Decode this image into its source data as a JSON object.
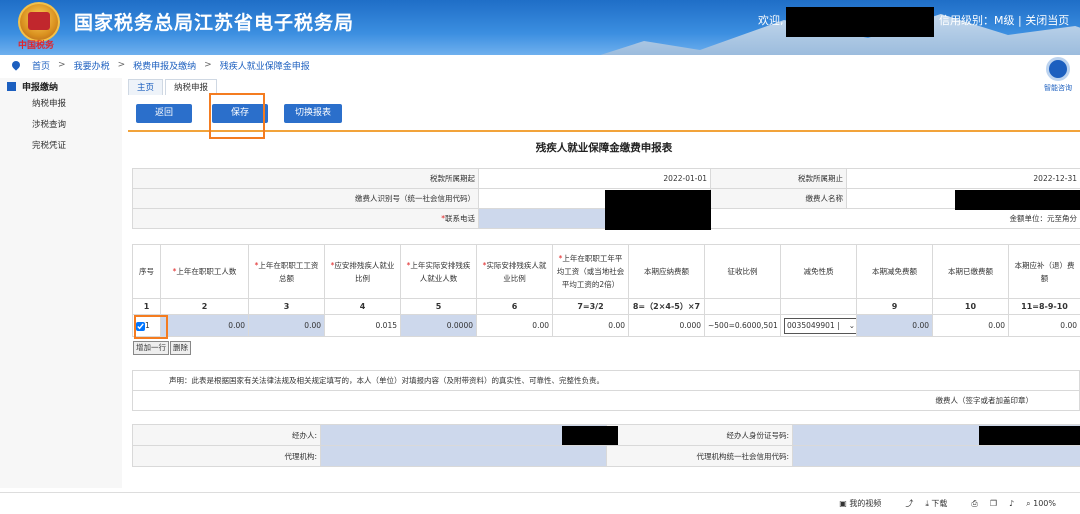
{
  "header": {
    "mark": "中国税务",
    "title": "国家税务总局江苏省电子税务局",
    "welcome": "欢迎,",
    "credit": "信用级别：M级 | 关闭当页"
  },
  "breadcrumb": [
    "首页",
    "我要办税",
    "税费申报及缴纳",
    "残疾人就业保障金申报"
  ],
  "sidebar": {
    "heading": "申报缴纳",
    "items": [
      "纳税申报",
      "涉税查询",
      "完税凭证"
    ]
  },
  "help_label": "智能咨询",
  "tabs": [
    "主页",
    "纳税申报"
  ],
  "toolbar": {
    "back": "返回",
    "save": "保存",
    "switch": "切换报表"
  },
  "form_title": "残疾人就业保障金缴费申报表",
  "info": {
    "period_start_label": "税款所属期起",
    "period_start": "2022-01-01",
    "period_end_label": "税款所属期止",
    "period_end": "2022-12-31",
    "taxpayer_id_label": "缴费人识别号（统一社会信用代码）",
    "taxpayer_name_label": "缴费人名称",
    "phone_req": "*",
    "phone_label": "联系电话",
    "unit_label": "金额单位：元至角分"
  },
  "grid": {
    "headers": [
      {
        "req": "",
        "text": "序号"
      },
      {
        "req": "*",
        "text": "上年在职职工人数"
      },
      {
        "req": "*",
        "text": "上年在职职工工资总额"
      },
      {
        "req": "*",
        "text": "应安排残疾人就业比例"
      },
      {
        "req": "*",
        "text": "上年实际安排残疾人就业人数"
      },
      {
        "req": "*",
        "text": "实际安排残疾人就业比例"
      },
      {
        "req": "*",
        "text": "上年在职职工年平均工资（或当地社会平均工资的2倍）"
      },
      {
        "req": "",
        "text": "本期应纳费额"
      },
      {
        "req": "",
        "text": "征收比例"
      },
      {
        "req": "",
        "text": "减免性质"
      },
      {
        "req": "",
        "text": "本期减免费额"
      },
      {
        "req": "",
        "text": "本期已缴费额"
      },
      {
        "req": "",
        "text": "本期应补（退）费额"
      }
    ],
    "numbers": [
      "1",
      "2",
      "3",
      "4",
      "5",
      "6",
      "7=3/2",
      "8=（2×4-5）×7",
      "",
      "",
      "9",
      "10",
      "11=8-9-10"
    ],
    "row": {
      "seq": "1",
      "workers": "0.00",
      "wages": "0.00",
      "ratio": "0.015",
      "disabled": "0.0000",
      "actual_ratio": "0.00",
      "avg_wage": "0.00",
      "payable": "0.000",
      "rate": "~500=0.6000,501",
      "relief": "0035049901 |",
      "reduced": "0.00",
      "paid": "0.00",
      "due": "0.00"
    },
    "add_row": "增加一行",
    "delete_row": "删除"
  },
  "declaration": {
    "text": "声明：此表是根据国家有关法律法规及相关规定填写的，本人（单位）对填报内容（及附带资料）的真实性、可靠性、完整性负责。",
    "sign": "缴费人（签字或者加盖印章）"
  },
  "agent": {
    "handler": "经办人:",
    "handler_id": "经办人身份证号码:",
    "agency": "代理机构:",
    "agency_code": "代理机构统一社会信用代码:"
  },
  "statusbar": [
    "我的视频",
    "下载",
    "100%"
  ]
}
